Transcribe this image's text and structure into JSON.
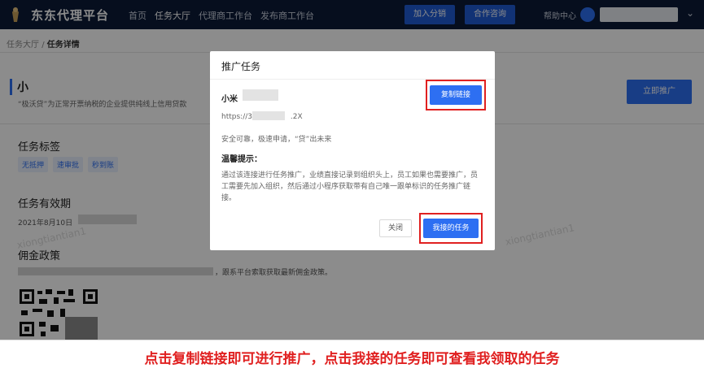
{
  "app": {
    "brand": "东东代理平台",
    "nav": [
      "首页",
      "任务大厅",
      "代理商工作台",
      "发布商工作台"
    ],
    "join_label": "加入分销",
    "consult_label": "合作咨询",
    "help_label": "帮助中心"
  },
  "breadcrumb": {
    "parent": "任务大厅",
    "separator": "/",
    "current": "任务详情"
  },
  "task": {
    "title": "小",
    "desc": "“极沃贷”为正常开票纳税的企业提供纯线上信用贷款",
    "promote_label": "立即推广",
    "tags_heading": "任务标签",
    "tags": [
      "无抵押",
      "速审批",
      "秒到账"
    ],
    "validity_heading": "任务有效期",
    "validity_date": "2021年8月10日",
    "policy_heading": "佣金政策",
    "policy_text": "，跟系平台索取获取最新佣金政策。"
  },
  "watermark": "xiongtiantian1",
  "modal": {
    "title": "推广任务",
    "product_name": "小米",
    "url": "https://3.",
    "url_tail": ".2X",
    "slogan": "安全可靠，极速申请，“贷”出未来",
    "tips_heading": "温馨提示：",
    "tips": "通过该连接进行任务推广，业绩直接记录到组织头上，员工如果也需要推广，员工需要先加入组织，然后通过小程序获取带有自己唯一跟单标识的任务推广链接。",
    "copy_label": "复制链接",
    "close_label": "关闭",
    "my_tasks_label": "我接的任务"
  },
  "caption": "点击复制链接即可进行推广，点击我接的任务即可查看我领取的任务",
  "colors": {
    "topbar": "#0b1a38",
    "accent": "#2d6ff2",
    "highlight": "#e02020"
  }
}
